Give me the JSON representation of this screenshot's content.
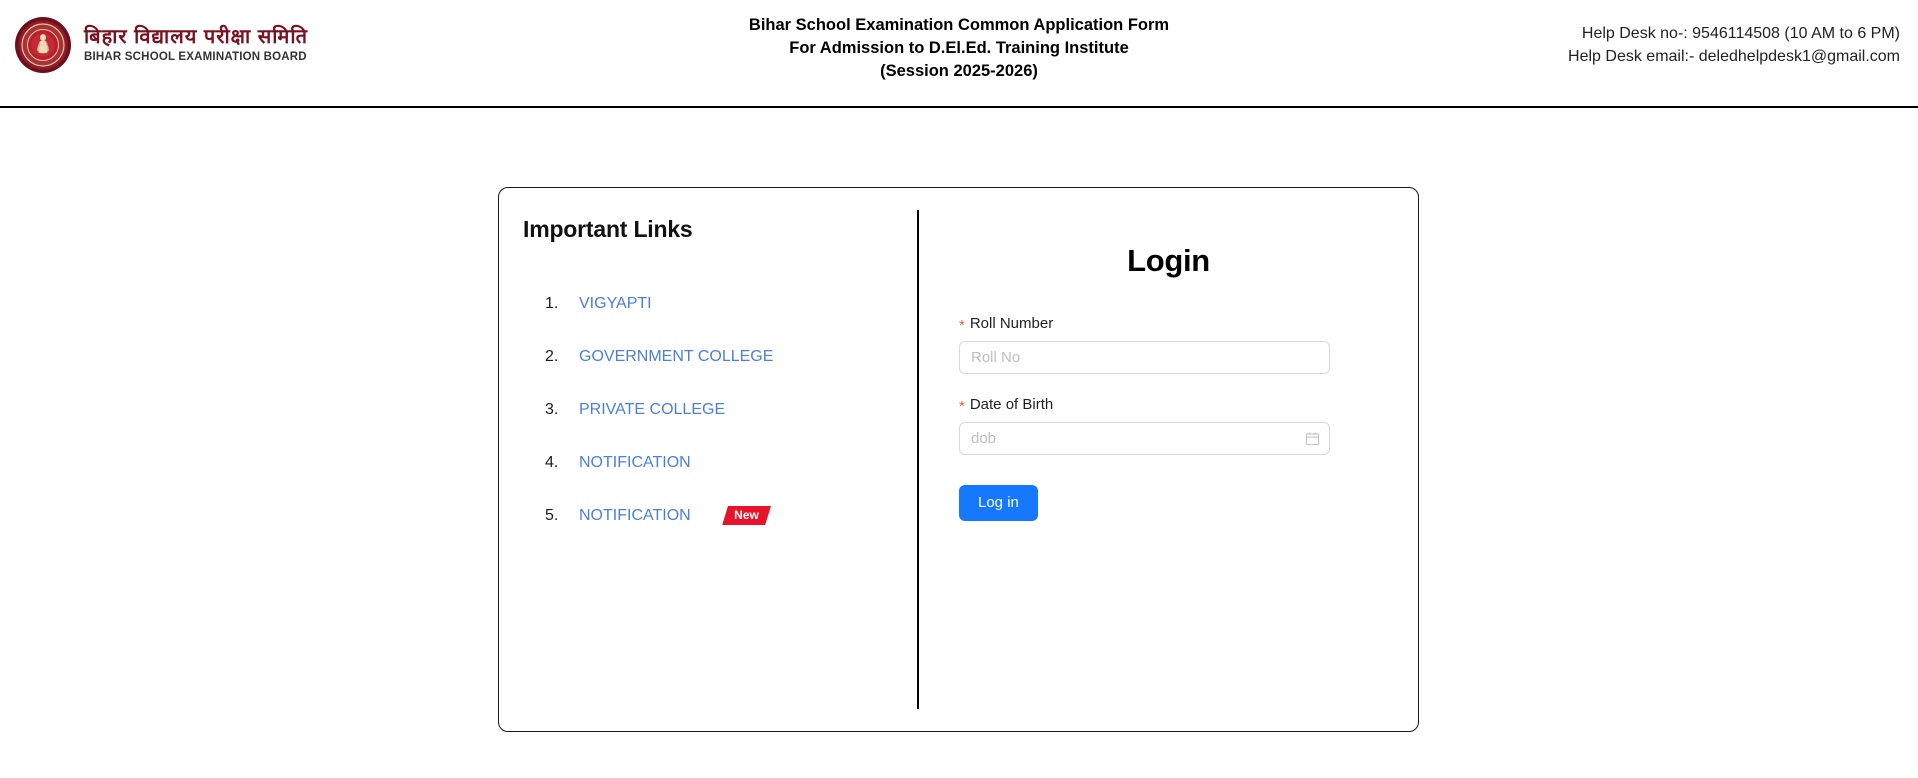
{
  "header": {
    "logo": {
      "icon": "bseb-seal-emblem",
      "hindi_name": "बिहार विद्यालय परीक्षा समिति",
      "english_name": "BIHAR SCHOOL EXAMINATION BOARD",
      "seal_color": "#7b1020"
    },
    "title_line1": "Bihar School Examination Common Application Form",
    "title_line2": "For Admission to D.El.Ed. Training Institute",
    "title_line3": "(Session 2025-2026)",
    "helpdesk_phone": "Help Desk no-: 9546114508 (10 AM to 6 PM)",
    "helpdesk_email": "Help Desk email:- deledhelpdesk1@gmail.com"
  },
  "important_links": {
    "heading": "Important Links",
    "items": [
      {
        "number": "1.",
        "label": "VIGYAPTI",
        "badge": ""
      },
      {
        "number": "2.",
        "label": "GOVERNMENT COLLEGE",
        "badge": ""
      },
      {
        "number": "3.",
        "label": "PRIVATE COLLEGE",
        "badge": ""
      },
      {
        "number": "4.",
        "label": "NOTIFICATION",
        "badge": ""
      },
      {
        "number": "5.",
        "label": "NOTIFICATION",
        "badge": "New"
      }
    ],
    "link_color": "#4a7fdc",
    "badge_color": "#e8122a"
  },
  "login": {
    "heading": "Login",
    "roll_label": "Roll Number",
    "roll_placeholder": "Roll No",
    "roll_value": "",
    "dob_label": "Date of Birth",
    "dob_placeholder": "dob",
    "dob_value": "",
    "dob_icon": "calendar-icon",
    "required_marker": "*",
    "submit_label": "Log in",
    "submit_color": "#1677ff"
  }
}
